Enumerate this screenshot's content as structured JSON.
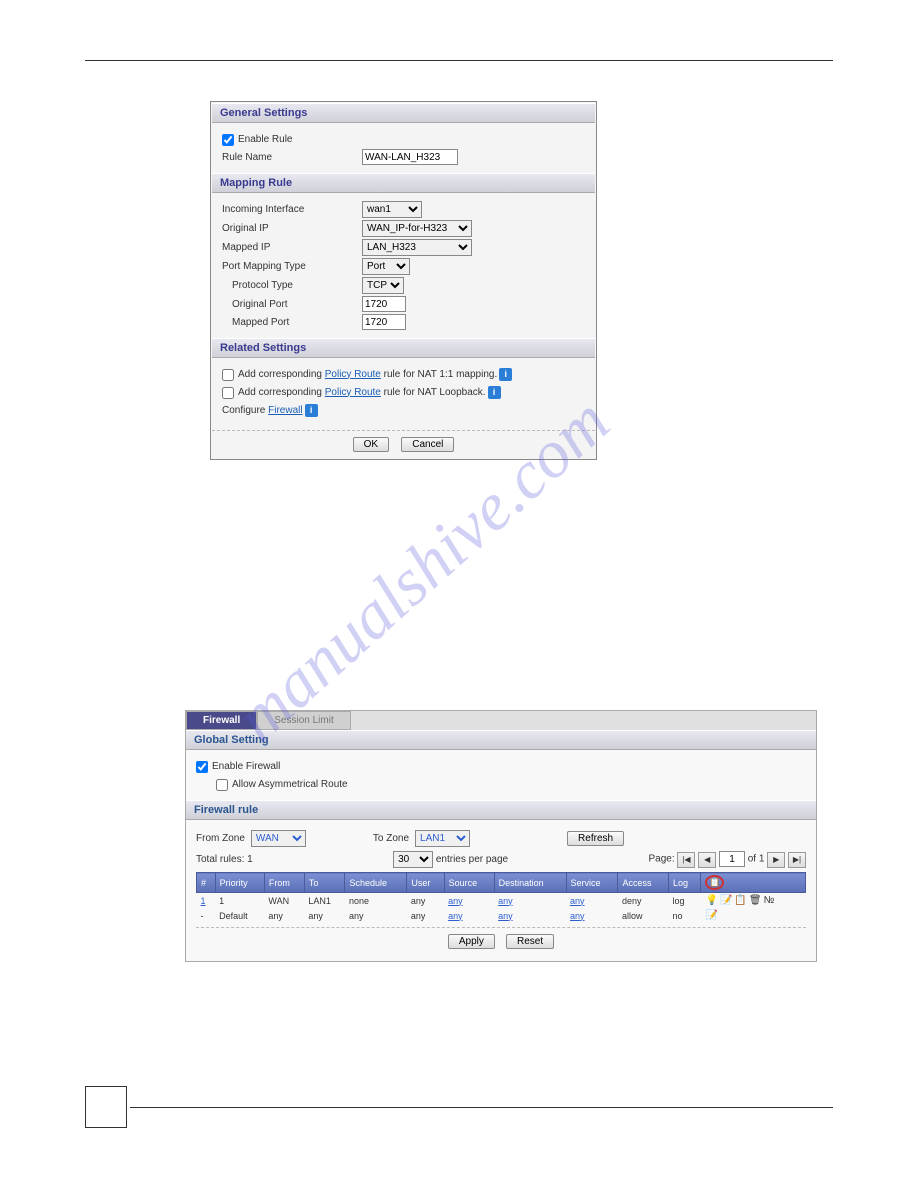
{
  "general": {
    "title": "General Settings",
    "enable_label": "Enable Rule",
    "rule_name_label": "Rule Name",
    "rule_name_value": "WAN-LAN_H323"
  },
  "mapping": {
    "title": "Mapping Rule",
    "incoming_iface_label": "Incoming Interface",
    "incoming_iface_value": "wan1",
    "original_ip_label": "Original IP",
    "original_ip_value": "WAN_IP-for-H323",
    "mapped_ip_label": "Mapped IP",
    "mapped_ip_value": "LAN_H323",
    "port_type_label": "Port Mapping Type",
    "port_type_value": "Port",
    "protocol_label": "Protocol Type",
    "protocol_value": "TCP",
    "original_port_label": "Original Port",
    "original_port_value": "1720",
    "mapped_port_label": "Mapped Port",
    "mapped_port_value": "1720"
  },
  "related": {
    "title": "Related Settings",
    "add_nat11_label": "Add corresponding",
    "policy_route_link": "Policy Route",
    "nat11_suffix": "rule for NAT 1:1 mapping.",
    "loopback_suffix": "rule for NAT Loopback.",
    "configure_label": "Configure",
    "firewall_link": "Firewall"
  },
  "buttons": {
    "ok": "OK",
    "cancel": "Cancel",
    "apply": "Apply",
    "reset": "Reset",
    "refresh": "Refresh"
  },
  "fw": {
    "tab_active": "Firewall",
    "tab_inactive": "Session Limit",
    "global_title": "Global Setting",
    "enable_fw": "Enable Firewall",
    "allow_asym": "Allow Asymmetrical Route",
    "rule_title": "Firewall rule",
    "from_zone_label": "From Zone",
    "from_zone_value": "WAN",
    "to_zone_label": "To Zone",
    "to_zone_value": "LAN1",
    "total_label": "Total rules: 1",
    "entries_select": "30",
    "entries_label": "entries per page",
    "page_label": "Page:",
    "page_value": "1",
    "of_label": "of 1",
    "cols": [
      "#",
      "Priority",
      "From",
      "To",
      "Schedule",
      "User",
      "Source",
      "Destination",
      "Service",
      "Access",
      "Log",
      ""
    ],
    "rows": [
      {
        "n": "1",
        "prio": "1",
        "from": "WAN",
        "to": "LAN1",
        "sch": "none",
        "user": "any",
        "src": "any",
        "dst": "any",
        "svc": "any",
        "acc": "deny",
        "log": "log"
      },
      {
        "n": "-",
        "prio": "Default",
        "from": "any",
        "to": "any",
        "sch": "any",
        "user": "any",
        "src": "any",
        "dst": "any",
        "svc": "any",
        "acc": "allow",
        "log": "no"
      }
    ]
  },
  "watermark": "manualshive.com"
}
